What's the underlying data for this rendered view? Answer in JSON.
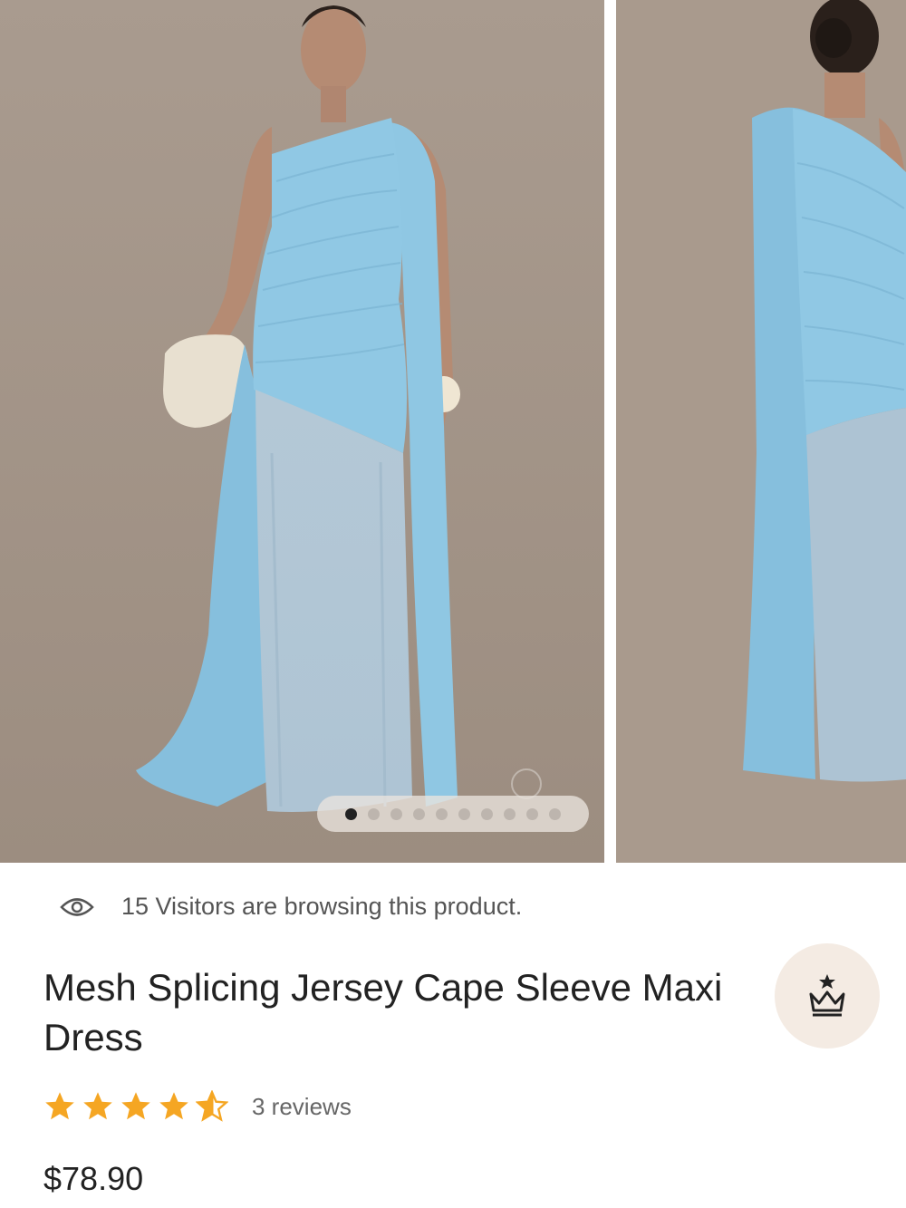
{
  "gallery": {
    "slide_count": 10,
    "active_index": 0,
    "images": [
      {
        "alt": "Model wearing light blue one-shoulder maxi dress with cape sleeve, holding clutch"
      },
      {
        "alt": "Back view of light blue cape sleeve dress"
      }
    ]
  },
  "visitors": {
    "text": "15 Visitors are browsing this product.",
    "icon": "eye-icon"
  },
  "product": {
    "title": "Mesh Splicing Jersey Cape Sleeve Maxi Dress",
    "rating": 4.5,
    "reviews_text": "3 reviews",
    "price": "$78.90"
  },
  "colors": {
    "star": "#f5a623",
    "crown_button_bg": "#f4ebe3",
    "dress": "#8ec6e3",
    "backdrop": "#a89a8d"
  }
}
